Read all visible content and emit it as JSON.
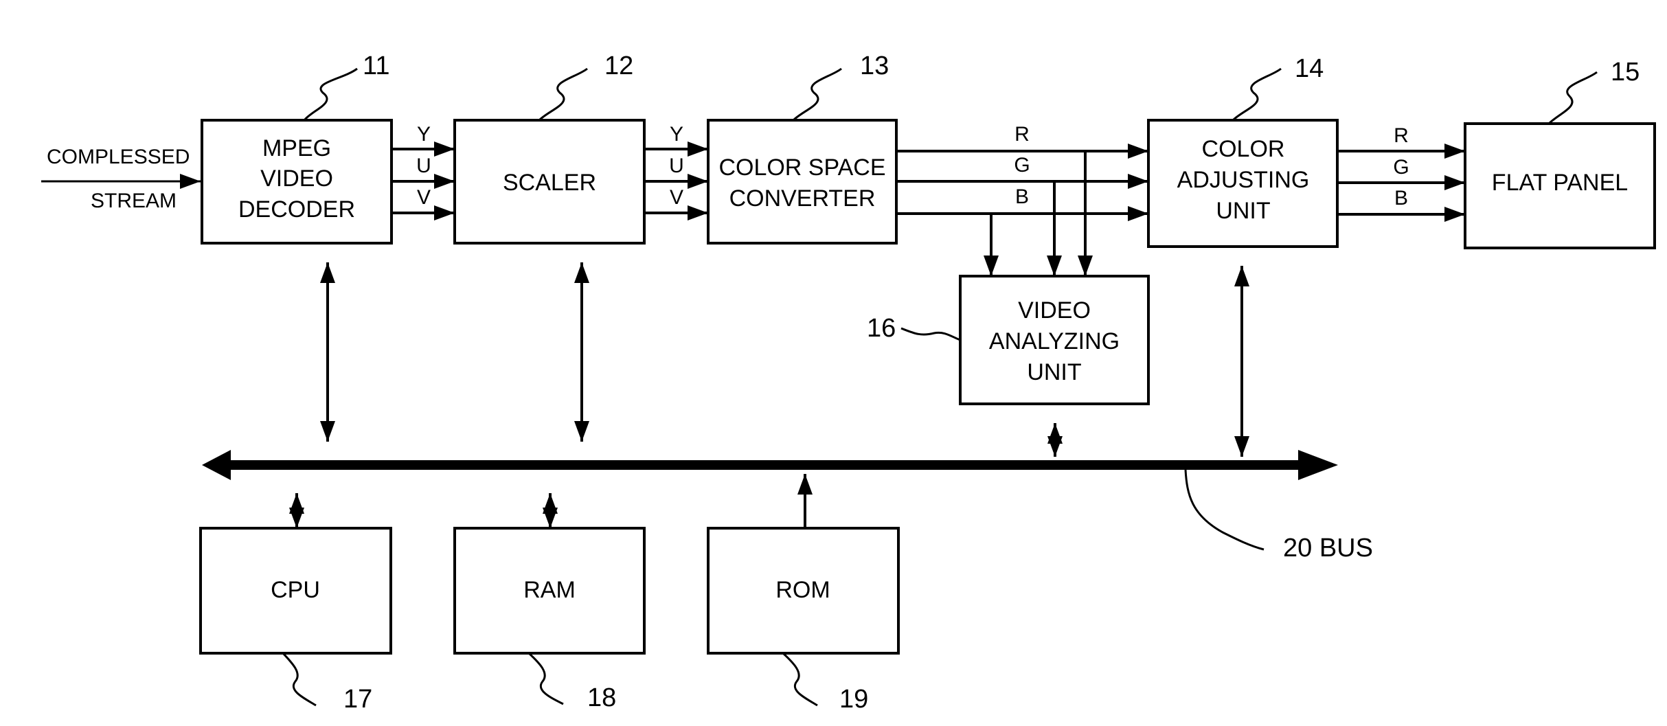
{
  "diagram": {
    "input_label_line1": "COMPLESSED",
    "input_label_line2": "STREAM",
    "blocks": [
      {
        "id": "11",
        "lines": [
          "MPEG",
          "VIDEO",
          "DECODER"
        ]
      },
      {
        "id": "12",
        "lines": [
          "SCALER"
        ]
      },
      {
        "id": "13",
        "lines": [
          "COLOR SPACE",
          "CONVERTER"
        ]
      },
      {
        "id": "14",
        "lines": [
          "COLOR",
          "ADJUSTING",
          "UNIT"
        ]
      },
      {
        "id": "15",
        "lines": [
          "FLAT PANEL"
        ]
      },
      {
        "id": "16",
        "lines": [
          "VIDEO",
          "ANALYZING",
          "UNIT"
        ]
      },
      {
        "id": "17",
        "lines": [
          "CPU"
        ]
      },
      {
        "id": "18",
        "lines": [
          "RAM"
        ]
      },
      {
        "id": "19",
        "lines": [
          "ROM"
        ]
      }
    ],
    "yuv_signals": [
      "Y",
      "U",
      "V"
    ],
    "rgb_signals": [
      "R",
      "G",
      "B"
    ],
    "bus_label": "20 BUS"
  }
}
